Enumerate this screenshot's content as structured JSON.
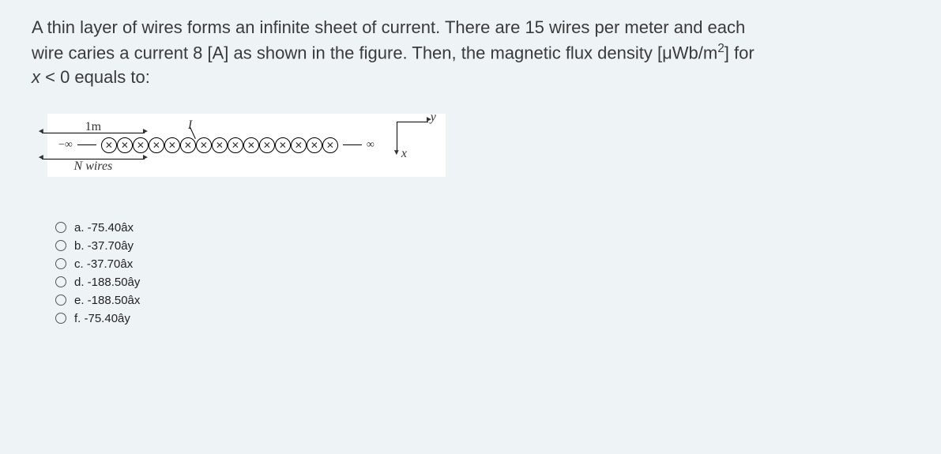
{
  "question": {
    "line1": "A thin layer of wires forms an infinite sheet of current. There are 15 wires per meter and each",
    "line2a": "wire caries a current 8 [A] as shown in the figure. Then, the magnetic flux density [μWb/m",
    "line2sup": "2",
    "line2b": "] for",
    "line3a": "x",
    "line3b": " < 0 equals to:"
  },
  "figure": {
    "neg_inf": "−∞",
    "pos_inf": "∞",
    "top_label": "1m",
    "bottom_label": "N wires",
    "current_label": "I",
    "axis_x": "x",
    "axis_y": "y",
    "wire_count": 15
  },
  "options": [
    {
      "key": "a.",
      "text": "-75.40âx"
    },
    {
      "key": "b.",
      "text": "-37.70ây"
    },
    {
      "key": "c.",
      "text": "-37.70âx"
    },
    {
      "key": "d.",
      "text": "-188.50ây"
    },
    {
      "key": "e.",
      "text": "-188.50âx"
    },
    {
      "key": "f.",
      "text": "-75.40ây"
    }
  ]
}
